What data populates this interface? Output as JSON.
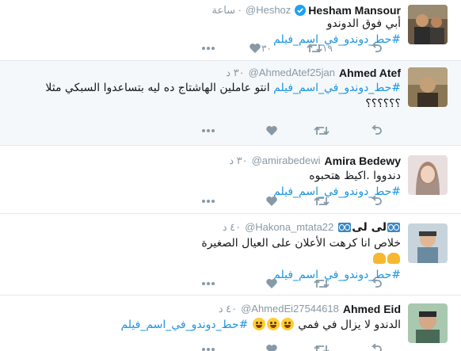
{
  "tweets": [
    {
      "name": "Hesham Mansour",
      "verified": true,
      "handle": "@Heshoz",
      "time": "· ساعة",
      "text": "أبي فوق الدوندو",
      "hashtag": "#حط_دوندو_في_اسم_فيلم",
      "retweets": "١٩",
      "likes": "٣٠"
    },
    {
      "name": "Ahmed Atef",
      "verified": false,
      "handle": "@AhmedAtef25jan",
      "time": "٣٠ د",
      "hashtag": "#حط_دوندو_في_اسم_فيلم",
      "text": "انتو عاملين الهاشتاج ده ليه بتساعدوا السبكي مثلا",
      "text2": "؟؟؟؟؟؟",
      "retweets": "",
      "likes": ""
    },
    {
      "name": "Amira Bedewy",
      "verified": false,
      "handle": "@amirabedewi",
      "time": "٣٠ د",
      "text": "دندووا .اكيظ هتحبوه",
      "hashtag": "#حط_دوندو_في_اسم_فيلم",
      "retweets": "",
      "likes": ""
    },
    {
      "name": "لى لى",
      "verified": false,
      "handle": "@Hakona_mtata22",
      "time": "٤٠ د",
      "text": "خلاص انا كرهت الأعلان على العيال الصغيرة",
      "hashtag": "#حط_دوندو_في_اسم_فيلم",
      "retweets": "",
      "likes": ""
    },
    {
      "name": "Ahmed Eid",
      "verified": false,
      "handle": "@AhmedEi27544618",
      "time": "٤٠ د",
      "text": "الدندو لا يزال في فمي",
      "hashtag": "#حط_دوندو_في_اسم_فيلم",
      "retweets": "",
      "likes": ""
    }
  ],
  "icons": {
    "reply": "reply-icon",
    "retweet": "retweet-icon",
    "like": "heart-icon",
    "more": "more-icon"
  },
  "colors": {
    "hashtag": "#1b95e0",
    "meta": "#8899a6",
    "verified": "#1da1f2"
  }
}
